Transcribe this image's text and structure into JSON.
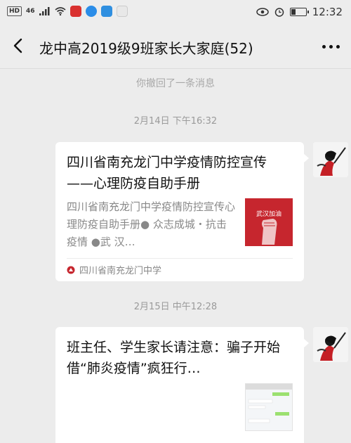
{
  "status_bar": {
    "network": "46",
    "time": "12:32"
  },
  "header": {
    "title": "龙中高2019级9班家长大家庭(52)"
  },
  "messages": {
    "recall_notice": "你撤回了一条消息",
    "timestamp_1": "2月14日 下午16:32",
    "timestamp_2": "2月15日 中午12:28"
  },
  "article_1": {
    "title": "四川省南充龙门中学疫情防控宣传——心理防疫自助手册",
    "summary": "四川省南充龙门中学疫情防控宣传心理防疫自助手册● 众志成城・抗击疫情 ●武 汉…",
    "thumb_text": "武汉加油",
    "source": "四川省南充龙门中学"
  },
  "article_2": {
    "title": "班主任、学生家长请注意：骗子开始借“肺炎疫情”疯狂行…"
  },
  "colors": {
    "background": "#ececec",
    "thumb_red": "#c6262e"
  }
}
